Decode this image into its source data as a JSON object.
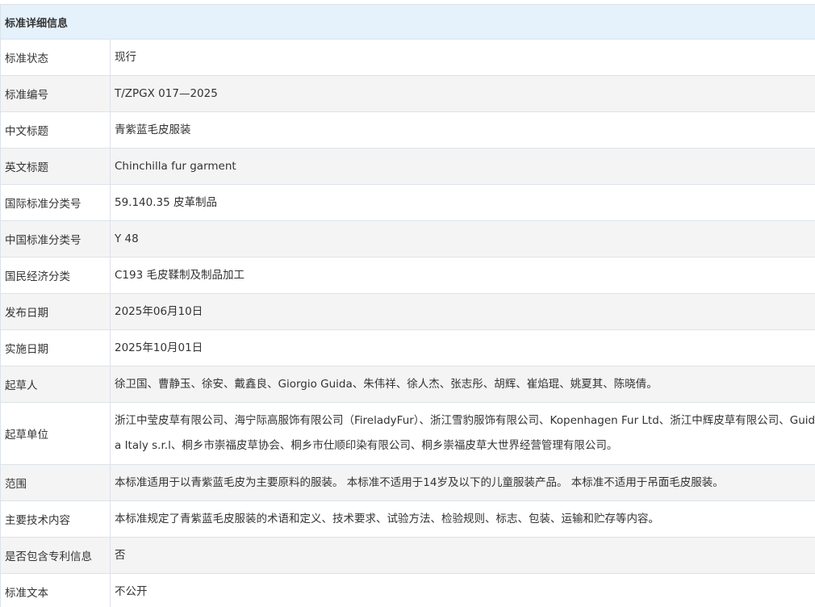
{
  "header": {
    "title": "标准详细信息"
  },
  "rows": [
    {
      "label": "标准状态",
      "value": "现行"
    },
    {
      "label": "标准编号",
      "value": "T/ZPGX 017—2025"
    },
    {
      "label": "中文标题",
      "value": "青紫蓝毛皮服装"
    },
    {
      "label": "英文标题",
      "value": "Chinchilla fur garment"
    },
    {
      "label": "国际标准分类号",
      "value": "59.140.35 皮革制品"
    },
    {
      "label": "中国标准分类号",
      "value": "Y 48"
    },
    {
      "label": "国民经济分类",
      "value": "C193 毛皮鞣制及制品加工"
    },
    {
      "label": "发布日期",
      "value": "2025年06月10日"
    },
    {
      "label": "实施日期",
      "value": "2025年10月01日"
    },
    {
      "label": "起草人",
      "value": "徐卫国、曹静玉、徐安、戴鑫良、Giorgio Guida、朱伟祥、徐人杰、张志彤、胡辉、崔焰琨、姚夏其、陈晓倩。"
    },
    {
      "label": "起草单位",
      "value": "浙江中莹皮草有限公司、海宁际高服饰有限公司（FireladyFur）、浙江雪豹服饰有限公司、Kopenhagen Fur Ltd、浙江中辉皮草有限公司、Guida Italy s.r.l、桐乡市崇福皮草协会、桐乡市仕顺印染有限公司、桐乡崇福皮草大世界经营管理有限公司。"
    },
    {
      "label": "范围",
      "value": "本标准适用于以青紫蓝毛皮为主要原料的服装。 本标准不适用于14岁及以下的儿童服装产品。 本标准不适用于吊面毛皮服装。"
    },
    {
      "label": "主要技术内容",
      "value": "本标准规定了青紫蓝毛皮服装的术语和定义、技术要求、试验方法、检验规则、标志、包装、运输和贮存等内容。"
    },
    {
      "label": "是否包含专利信息",
      "value": "否"
    },
    {
      "label": "标准文本",
      "value": "不公开"
    }
  ]
}
